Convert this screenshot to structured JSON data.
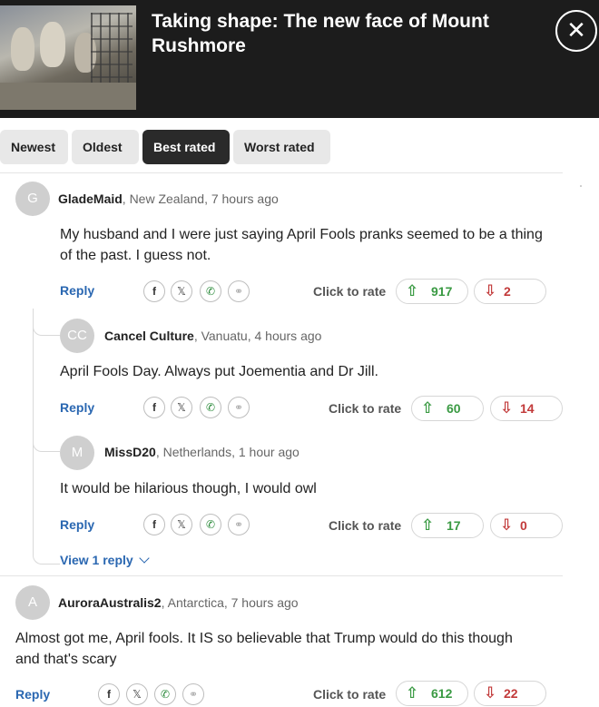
{
  "header": {
    "title": "Taking shape: The new face of Mount Rushmore",
    "close_icon": "close-icon"
  },
  "sort_tabs": [
    {
      "label": "Newest",
      "active": false
    },
    {
      "label": "Oldest",
      "active": false
    },
    {
      "label": "Best rated",
      "active": true
    },
    {
      "label": "Worst rated",
      "active": false
    }
  ],
  "ui": {
    "reply_label": "Reply",
    "click_to_rate": "Click to rate",
    "view_replies": "View 1 reply",
    "share_icons": [
      "facebook-icon",
      "x-icon",
      "whatsapp-icon",
      "link-icon"
    ],
    "up_color": "#3a9a43",
    "down_color": "#c23a3a",
    "link_color": "#2a67b1"
  },
  "comments": [
    {
      "initial": "G",
      "author": "GladeMaid",
      "meta": ", New Zealand, 7 hours ago",
      "text": "My husband and I were just saying April Fools pranks seemed to be a thing of the past. I guess not.",
      "up": "917",
      "down": "2",
      "replies": [
        {
          "initial": "CC",
          "author": "Cancel Culture",
          "meta": ", Vanuatu, 4 hours ago",
          "text": "April Fools Day. Always put Joementia and Dr Jill.",
          "up": "60",
          "down": "14"
        },
        {
          "initial": "M",
          "author": "MissD20",
          "meta": ", Netherlands, 1 hour ago",
          "text": "It would be hilarious though, I would owl",
          "up": "17",
          "down": "0"
        }
      ]
    },
    {
      "initial": "A",
      "author": "AuroraAustralis2",
      "meta": ", Antarctica, 7 hours ago",
      "text": "Almost got me, April fools. It IS so believable that Trump would do this though and that's scary",
      "up": "612",
      "down": "22"
    }
  ]
}
